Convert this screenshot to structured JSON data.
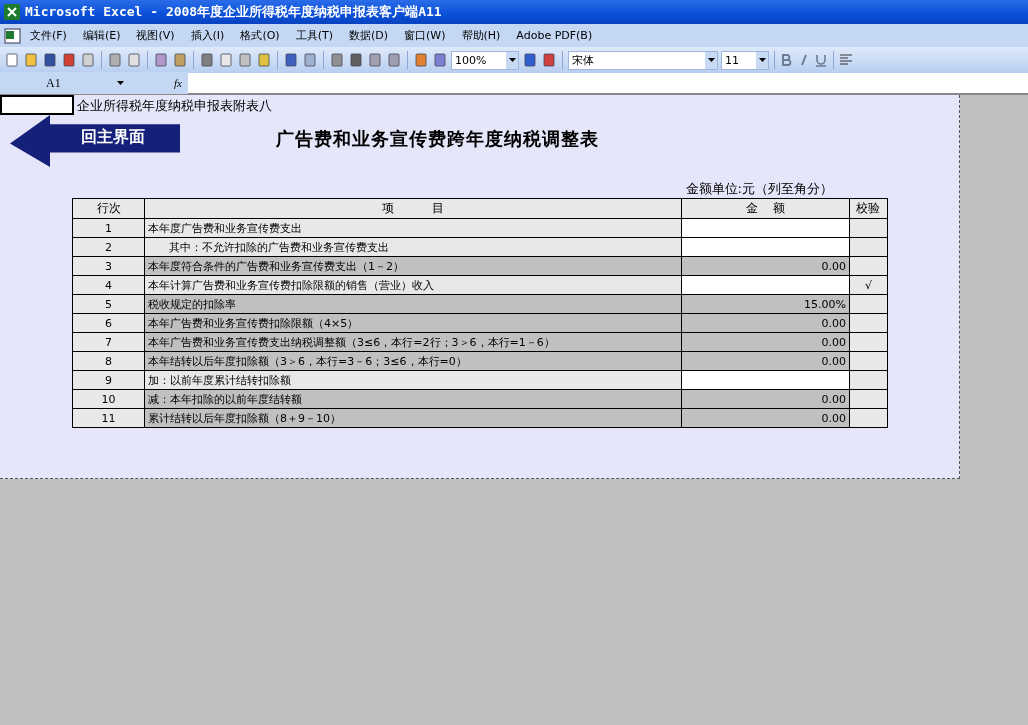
{
  "window": {
    "title": "Microsoft Excel - 2008年度企业所得税年度纳税申报表客户端A11"
  },
  "menu": [
    "文件(F)",
    "编辑(E)",
    "视图(V)",
    "插入(I)",
    "格式(O)",
    "工具(T)",
    "数据(D)",
    "窗口(W)",
    "帮助(H)",
    "Adobe PDF(B)"
  ],
  "toolbar": {
    "zoom": "100%",
    "font": "宋体",
    "font_size": "11"
  },
  "formula_bar": {
    "name_box": "A1",
    "fx": "fx"
  },
  "sheet": {
    "caption": "企业所得税年度纳税申报表附表八",
    "back_button": "回主界面",
    "title": "广告费和业务宣传费跨年度纳税调整表",
    "unit": "金额单位:元（列至角分）",
    "columns": [
      "行次",
      "项          目",
      "金    额",
      "校验"
    ],
    "rows": [
      {
        "no": "1",
        "item": "本年度广告费和业务宣传费支出",
        "kind": "input"
      },
      {
        "no": "2",
        "item": "      其中：不允许扣除的广告费和业务宣传费支出",
        "kind": "input"
      },
      {
        "no": "3",
        "item": "本年度符合条件的广告费和业务宣传费支出（1－2）",
        "kind": "computed",
        "amount": "0.00"
      },
      {
        "no": "4",
        "item": "本年计算广告费和业务宣传费扣除限额的销售（营业）收入",
        "kind": "input",
        "check": "√"
      },
      {
        "no": "5",
        "item": "税收规定的扣除率",
        "kind": "computed",
        "amount": "15.00%"
      },
      {
        "no": "6",
        "item": "本年广告费和业务宣传费扣除限额（4×5）",
        "kind": "computed",
        "amount": "0.00"
      },
      {
        "no": "7",
        "item": "本年广告费和业务宣传费支出纳税调整额（3≤6，本行=2行；3＞6，本行=1－6）",
        "kind": "computed",
        "amount": "0.00"
      },
      {
        "no": "8",
        "item": "本年结转以后年度扣除额（3＞6，本行=3－6；3≤6，本行=0）",
        "kind": "computed",
        "amount": "0.00"
      },
      {
        "no": "9",
        "item": "加：以前年度累计结转扣除额",
        "kind": "input"
      },
      {
        "no": "10",
        "item": "减：本年扣除的以前年度结转额",
        "kind": "computed",
        "amount": "0.00"
      },
      {
        "no": "11",
        "item": "累计结转以后年度扣除额（8＋9－10）",
        "kind": "computed",
        "amount": "0.00"
      }
    ]
  }
}
